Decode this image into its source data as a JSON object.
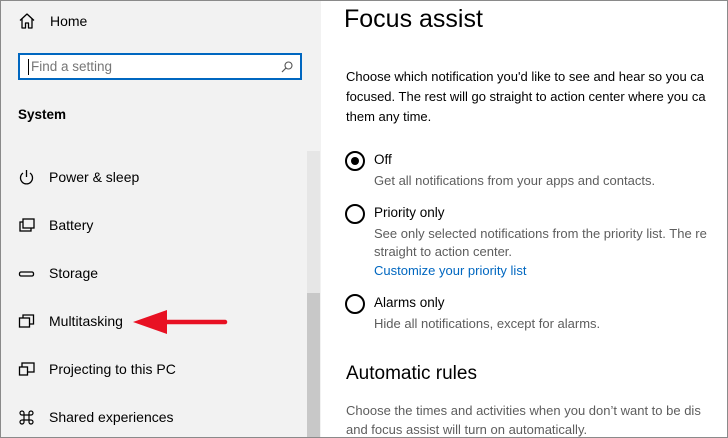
{
  "sidebar": {
    "home_label": "Home",
    "search": {
      "placeholder": "Find a setting"
    },
    "section_title": "System",
    "items": [
      {
        "label": "Power & sleep",
        "icon": "power-icon"
      },
      {
        "label": "Battery",
        "icon": "battery-icon"
      },
      {
        "label": "Storage",
        "icon": "storage-icon"
      },
      {
        "label": "Multitasking",
        "icon": "multitasking-icon"
      },
      {
        "label": "Projecting to this PC",
        "icon": "projecting-icon"
      },
      {
        "label": "Shared experiences",
        "icon": "shared-experiences-icon"
      }
    ],
    "annotation_arrow_color": "#e81123"
  },
  "main": {
    "title": "Focus assist",
    "description_lines": [
      "Choose which notification you'd like to see and hear so you ca",
      "focused. The rest will go straight to action center where you ca",
      "them any time."
    ],
    "options": [
      {
        "label": "Off",
        "checked": true,
        "sub_lines": [
          "Get all notifications from your apps and contacts."
        ]
      },
      {
        "label": "Priority only",
        "checked": false,
        "sub_lines": [
          "See only selected notifications from the priority list. The re",
          "straight to action center."
        ],
        "link": "Customize your priority list"
      },
      {
        "label": "Alarms only",
        "checked": false,
        "sub_lines": [
          "Hide all notifications, except for alarms."
        ]
      }
    ],
    "rules_title": "Automatic rules",
    "rules_lines": [
      "Choose the times and activities when you don’t want to be dis",
      "and focus assist will turn on automatically."
    ]
  },
  "colors": {
    "accent": "#0067c0",
    "sidebar_bg": "#f2f2f2",
    "arrow": "#e81123"
  }
}
